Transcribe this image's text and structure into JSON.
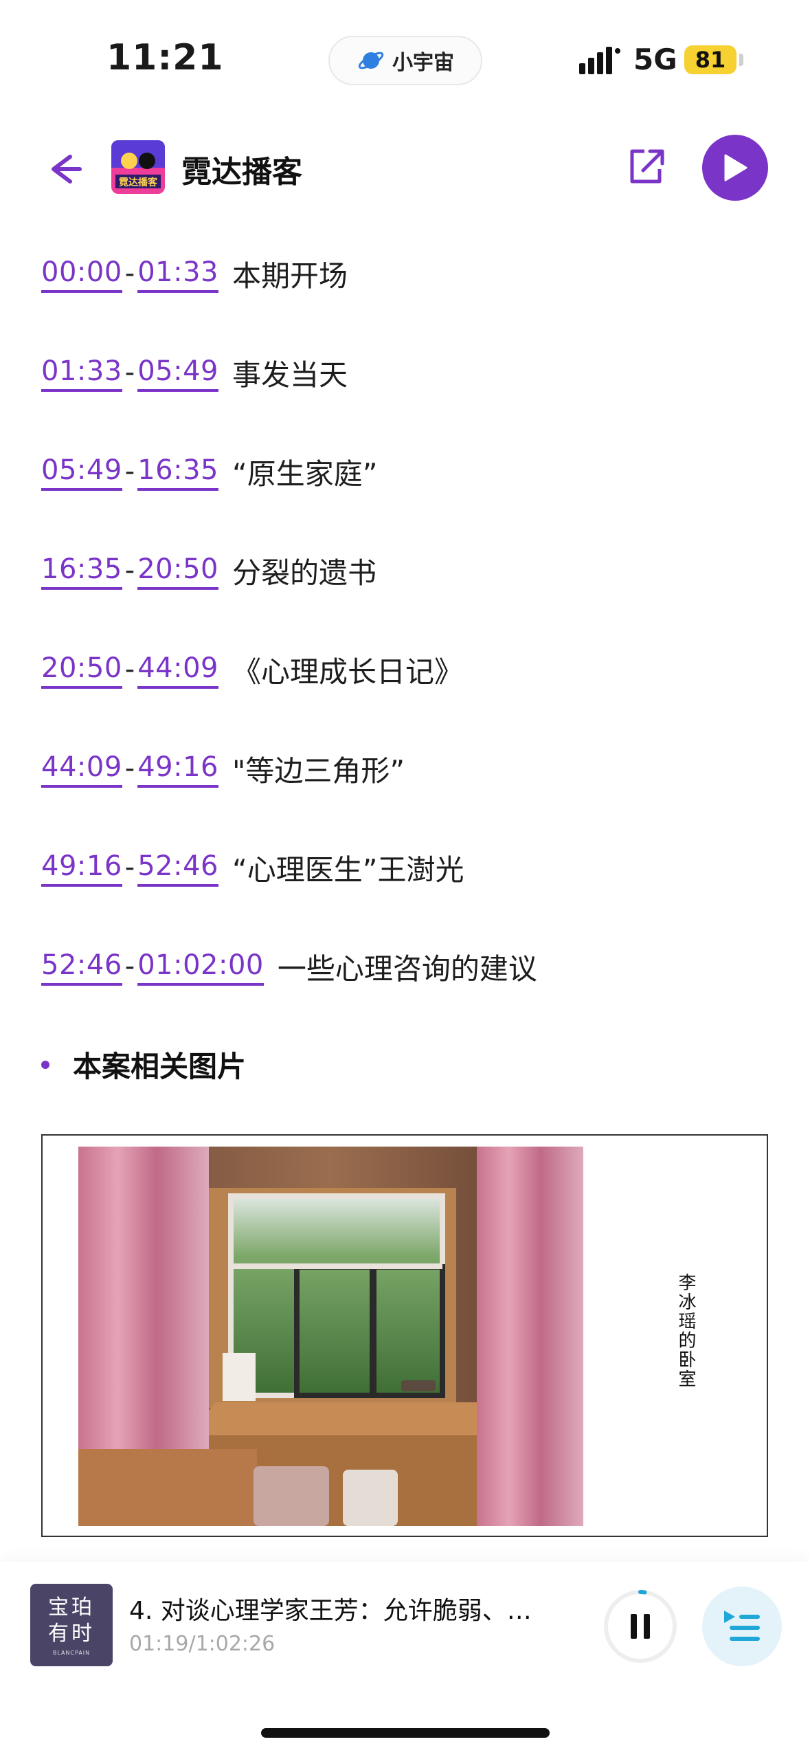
{
  "status_bar": {
    "time": "11:21",
    "pill_label": "小宇宙",
    "network": "5G",
    "battery": "81"
  },
  "header": {
    "title": "霓达播客",
    "cover_label": "霓达播客"
  },
  "chapters": [
    {
      "start": "00:00",
      "end": "01:33",
      "title": "本期开场"
    },
    {
      "start": "01:33",
      "end": "05:49",
      "title": "事发当天"
    },
    {
      "start": "05:49",
      "end": "16:35",
      "title": "“原生家庭”"
    },
    {
      "start": "16:35",
      "end": "20:50",
      "title": "分裂的遗书"
    },
    {
      "start": "20:50",
      "end": "44:09",
      "title": "《心理成长日记》"
    },
    {
      "start": "44:09",
      "end": "49:16",
      "title": "\"等边三角形”"
    },
    {
      "start": "49:16",
      "end": "52:46",
      "title": "“心理医生”王澍光"
    },
    {
      "start": "52:46",
      "end": "01:02:00",
      "title": "一些心理咨询的建议"
    }
  ],
  "separator": "-",
  "section": {
    "title": "本案相关图片"
  },
  "image_card": {
    "caption": "李冰瑶的卧室"
  },
  "mini_player": {
    "cover_line1": "宝珀",
    "cover_line2": "有时",
    "cover_sub": "BLANCPAIN",
    "title": "4. 对谈心理学家王芳：允许脆弱、…",
    "time": "01:19/1:02:26",
    "progress": 0.021
  },
  "colors": {
    "accent": "#7b34c8",
    "playlist_bg": "#e4f3fa",
    "playlist_icon": "#1fa7d8",
    "battery": "#f7d031"
  }
}
